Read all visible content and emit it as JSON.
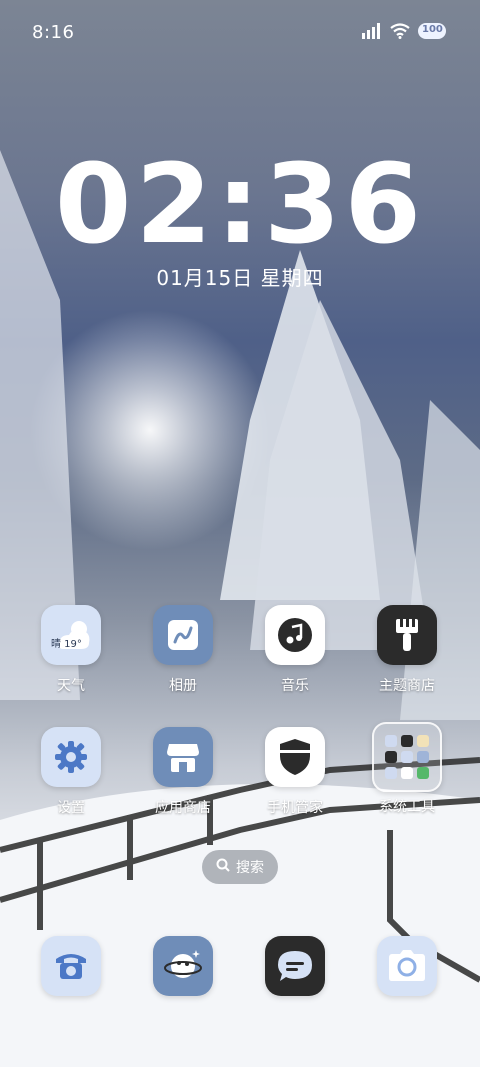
{
  "status_bar": {
    "time": "8:16",
    "battery": "100"
  },
  "clock": {
    "time": "02:36",
    "date": "01月15日 星期四"
  },
  "apps": [
    {
      "label": "天气",
      "icon": "weather-icon",
      "temp": "晴 19°"
    },
    {
      "label": "相册",
      "icon": "gallery-icon"
    },
    {
      "label": "音乐",
      "icon": "music-icon"
    },
    {
      "label": "主题商店",
      "icon": "theme-store-icon"
    },
    {
      "label": "设置",
      "icon": "settings-gear-icon"
    },
    {
      "label": "应用商店",
      "icon": "app-store-icon"
    },
    {
      "label": "手机管家",
      "icon": "security-shield-icon"
    },
    {
      "label": "系统工具",
      "icon": "folder-icon"
    }
  ],
  "search": {
    "label": "搜索"
  },
  "dock": [
    {
      "icon": "phone-icon"
    },
    {
      "icon": "browser-planet-icon"
    },
    {
      "icon": "messages-icon"
    },
    {
      "icon": "camera-icon"
    }
  ]
}
